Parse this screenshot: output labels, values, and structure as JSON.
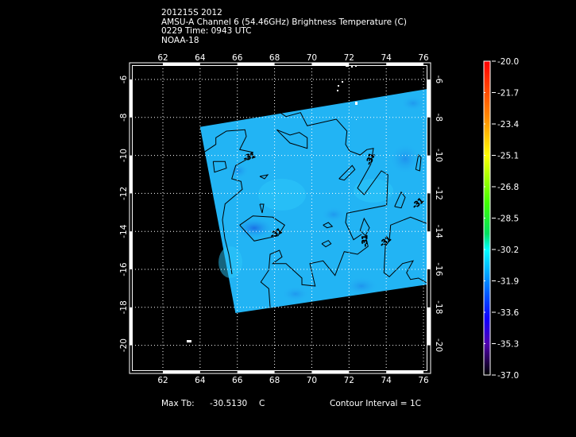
{
  "header": {
    "line1": "201215S 2012",
    "line2": "AMSU-A Channel 6 (54.46GHz) Brightness Temperature (C)",
    "line3": "0229 Time: 0943 UTC",
    "line4": "NOAA-18"
  },
  "footer": {
    "max_label": "Max Tb:",
    "max_value": "-30.5130",
    "max_unit": "C",
    "contour_interval": "Contour Interval = 1C"
  },
  "chart_data": {
    "type": "heatmap",
    "title": "AMSU-A Channel 6 (54.46GHz) Brightness Temperature (C)",
    "lon_ticks": [
      "62",
      "64",
      "66",
      "68",
      "70",
      "72",
      "74",
      "76"
    ],
    "lat_ticks": [
      "-6",
      "-8",
      "-10",
      "-12",
      "-14",
      "-16",
      "-18",
      "-20"
    ],
    "lon_range": [
      60.3,
      76.2
    ],
    "lat_range": [
      -21.4,
      -5.25
    ],
    "grid": true,
    "swath_corners_lonlat": [
      [
        64.0,
        -8.5
      ],
      [
        76.2,
        -6.5
      ],
      [
        76.2,
        -16.8
      ],
      [
        65.9,
        -18.3
      ]
    ],
    "field_color": "#22b4f4",
    "cold_spot_color": "#1a78e8",
    "contour_label": "-31",
    "colorbar": {
      "labels": [
        "-20.0",
        "-21.7",
        "-23.4",
        "-25.1",
        "-26.8",
        "-28.5",
        "-30.2",
        "-31.9",
        "-33.6",
        "-35.3",
        "-37.0"
      ],
      "range": [
        -37.0,
        -20.0
      ],
      "colors": [
        "#ff0000",
        "#ff8000",
        "#ffff00",
        "#00ff00",
        "#00ffff",
        "#0000ff",
        "#5000c8",
        "#000000"
      ]
    }
  }
}
